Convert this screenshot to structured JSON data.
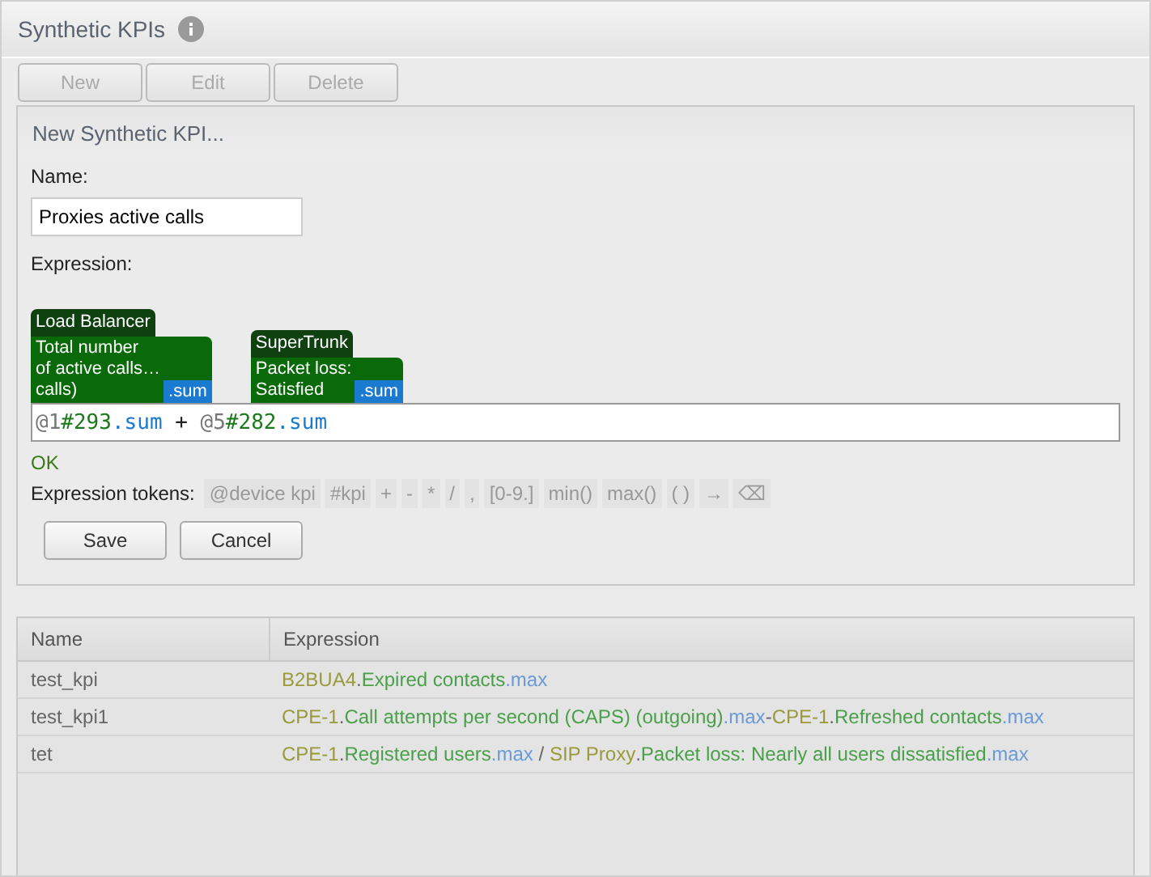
{
  "header": {
    "title": "Synthetic KPIs"
  },
  "toolbar": [
    {
      "label": "New",
      "disabled": true
    },
    {
      "label": "Edit",
      "disabled": true
    },
    {
      "label": "Delete",
      "disabled": true
    }
  ],
  "form": {
    "title": "New Synthetic KPI...",
    "name_label": "Name:",
    "name_value": "Proxies active calls",
    "expression_label": "Expression:",
    "chips": [
      {
        "device": "Load Balancer",
        "kpi_lines": [
          "Total number",
          "of active calls…",
          "calls)"
        ],
        "agg": ".sum"
      },
      {
        "device": "SuperTrunk",
        "kpi_lines": [
          "Packet loss:",
          "Satisfied"
        ],
        "agg": ".sum"
      }
    ],
    "expression": [
      {
        "kind": "device",
        "text": "@1"
      },
      {
        "kind": "kpi",
        "text": "#293"
      },
      {
        "kind": "agg",
        "text": ".sum"
      },
      {
        "kind": "op",
        "text": " + "
      },
      {
        "kind": "device",
        "text": "@5"
      },
      {
        "kind": "kpi",
        "text": "#282"
      },
      {
        "kind": "agg",
        "text": ".sum"
      }
    ],
    "status": "OK",
    "tokens_label": "Expression tokens:",
    "tokens": [
      "@device kpi",
      "#kpi",
      "+",
      "-",
      "*",
      "/",
      ",",
      "[0-9.]",
      "min()",
      "max()",
      "( )",
      "→",
      "⌫"
    ],
    "buttons": [
      "Save",
      "Cancel"
    ]
  },
  "table": {
    "columns": [
      "Name",
      "Expression"
    ],
    "rows": [
      {
        "name": "test_kpi",
        "expression": [
          {
            "kind": "device",
            "text": "B2BUA4"
          },
          {
            "kind": "op",
            "text": "."
          },
          {
            "kind": "kpi",
            "text": "Expired contacts"
          },
          {
            "kind": "agg",
            "text": ".max"
          }
        ]
      },
      {
        "name": "test_kpi1",
        "expression": [
          {
            "kind": "device",
            "text": "CPE-1"
          },
          {
            "kind": "op",
            "text": "."
          },
          {
            "kind": "kpi",
            "text": "Call attempts per second (CAPS) (outgoing)"
          },
          {
            "kind": "agg",
            "text": ".max"
          },
          {
            "kind": "op",
            "text": "-"
          },
          {
            "kind": "device",
            "text": "CPE-1"
          },
          {
            "kind": "op",
            "text": "."
          },
          {
            "kind": "kpi",
            "text": "Refreshed contacts"
          },
          {
            "kind": "agg",
            "text": ".max"
          }
        ]
      },
      {
        "name": "tet",
        "expression": [
          {
            "kind": "device",
            "text": "CPE-1"
          },
          {
            "kind": "op",
            "text": "."
          },
          {
            "kind": "kpi",
            "text": "Registered users"
          },
          {
            "kind": "agg",
            "text": ".max"
          },
          {
            "kind": "op",
            "text": " / "
          },
          {
            "kind": "device",
            "text": "SIP Proxy"
          },
          {
            "kind": "op",
            "text": "."
          },
          {
            "kind": "kpi",
            "text": "Packet loss: Nearly all users dissatisfied"
          },
          {
            "kind": "agg",
            "text": ".max"
          }
        ]
      }
    ]
  }
}
